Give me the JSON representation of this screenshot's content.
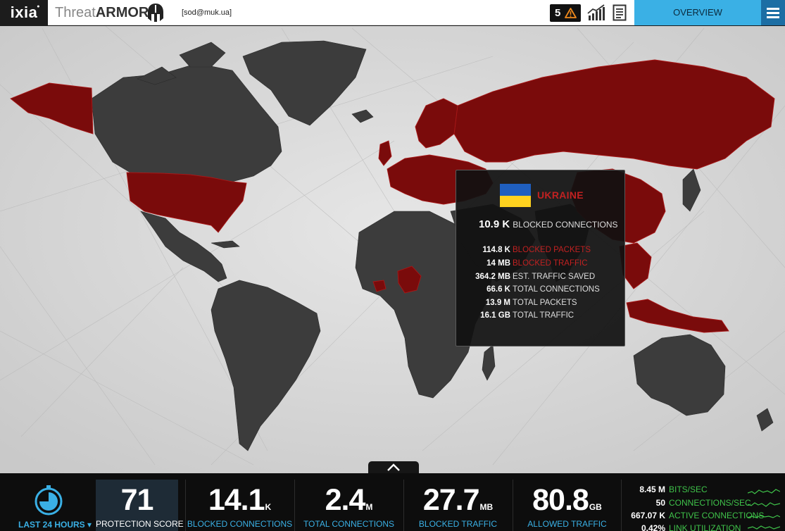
{
  "header": {
    "logo": "ixia",
    "product_light": "Threat",
    "product_bold": "ARMOR",
    "account": "[sod@muk.ua]",
    "alert_count": "5",
    "overview_label": "OVERVIEW"
  },
  "tooltip": {
    "country": "UKRAINE",
    "main_value": "10.9 K",
    "main_label": "BLOCKED CONNECTIONS",
    "rows": [
      {
        "value": "114.8 K",
        "label": "BLOCKED PACKETS"
      },
      {
        "value": "14 MB",
        "label": "BLOCKED TRAFFIC"
      },
      {
        "value": "364.2 MB",
        "label": "EST. TRAFFIC SAVED"
      },
      {
        "value": "66.6 K",
        "label": "TOTAL CONNECTIONS"
      },
      {
        "value": "13.9 M",
        "label": "TOTAL PACKETS"
      },
      {
        "value": "16.1 GB",
        "label": "TOTAL TRAFFIC"
      }
    ]
  },
  "footer": {
    "range_label": "LAST 24 HOURS ▾",
    "protection_score": {
      "value": "71",
      "label": "PROTECTION SCORE"
    },
    "blocked_connections": {
      "value": "14.1",
      "unit": "K",
      "label": "BLOCKED CONNECTIONS"
    },
    "total_connections": {
      "value": "2.4",
      "unit": "M",
      "label": "TOTAL CONNECTIONS"
    },
    "blocked_traffic": {
      "value": "27.7",
      "unit": "MB",
      "label": "BLOCKED TRAFFIC"
    },
    "allowed_traffic": {
      "value": "80.8",
      "unit": "GB",
      "label": "ALLOWED TRAFFIC"
    },
    "live": [
      {
        "value": "8.45 M",
        "label": "BITS/SEC"
      },
      {
        "value": "50",
        "label": "CONNECTIONS/SEC"
      },
      {
        "value": "667.07 K",
        "label": "ACTIVE CONNECTIONS"
      },
      {
        "value": "0.42%",
        "label": "LINK UTILIZATION"
      }
    ]
  },
  "colors": {
    "accent_blue": "#3ab0e5",
    "blocked_red": "#7a0b0b",
    "land_gray": "#3c3c3c",
    "live_green": "#3fc24a"
  },
  "icons": [
    "helmet-icon",
    "warning-icon",
    "stats-icon",
    "report-icon",
    "menu-icon",
    "chevron-up-icon",
    "stopwatch-icon"
  ]
}
